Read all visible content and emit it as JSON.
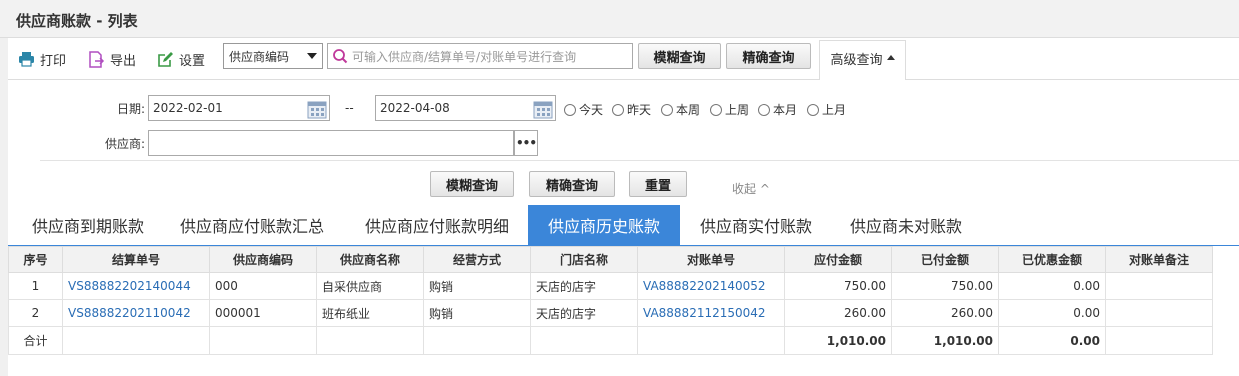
{
  "page_title": "供应商账款 - 列表",
  "toolbar": {
    "print_label": "打印",
    "export_label": "导出",
    "settings_label": "设置",
    "search_field_select": "供应商编码",
    "search_placeholder": "可输入供应商/结算单号/对账单号进行查询",
    "fuzzy_query_label": "模糊查询",
    "exact_query_label": "精确查询",
    "advanced_query_label": "高级查询"
  },
  "filters": {
    "date_label": "日期:",
    "date_from": "2022-02-01",
    "date_sep": "--",
    "date_to": "2022-04-08",
    "quick_ranges": [
      "今天",
      "昨天",
      "本周",
      "上周",
      "本月",
      "上月"
    ],
    "supplier_label": "供应商:",
    "supplier_value": "",
    "more_label": "•••",
    "fuzzy_query_label": "模糊查询",
    "exact_query_label": "精确查询",
    "reset_label": "重置",
    "collapse_label": "收起 ^"
  },
  "tabs": [
    {
      "label": "供应商到期账款",
      "active": false
    },
    {
      "label": "供应商应付账款汇总",
      "active": false
    },
    {
      "label": "供应商应付账款明细",
      "active": false
    },
    {
      "label": "供应商历史账款",
      "active": true
    },
    {
      "label": "供应商实付账款",
      "active": false
    },
    {
      "label": "供应商未对账款",
      "active": false
    }
  ],
  "table": {
    "columns": [
      "序号",
      "结算单号",
      "供应商编码",
      "供应商名称",
      "经营方式",
      "门店名称",
      "对账单号",
      "应付金额",
      "已付金额",
      "已优惠金额",
      "对账单备注"
    ],
    "rows": [
      [
        "1",
        "VS88882202140044",
        "000",
        "自采供应商",
        "购销",
        "天店的店字",
        "VA88882202140052",
        "750.00",
        "750.00",
        "0.00",
        ""
      ],
      [
        "2",
        "VS88882202110042",
        "000001",
        "班布纸业",
        "购销",
        "天店的店字",
        "VA88882112150042",
        "260.00",
        "260.00",
        "0.00",
        ""
      ]
    ],
    "total": [
      "合计",
      "",
      "",
      "",
      "",
      "",
      "",
      "1,010.00",
      "1,010.00",
      "0.00",
      ""
    ]
  },
  "colors": {
    "accent": "#3b86d9",
    "link": "#2a6db5",
    "icon_green": "#3a9a45",
    "icon_purple": "#b04fc0",
    "icon_teal": "#2b86a8"
  }
}
